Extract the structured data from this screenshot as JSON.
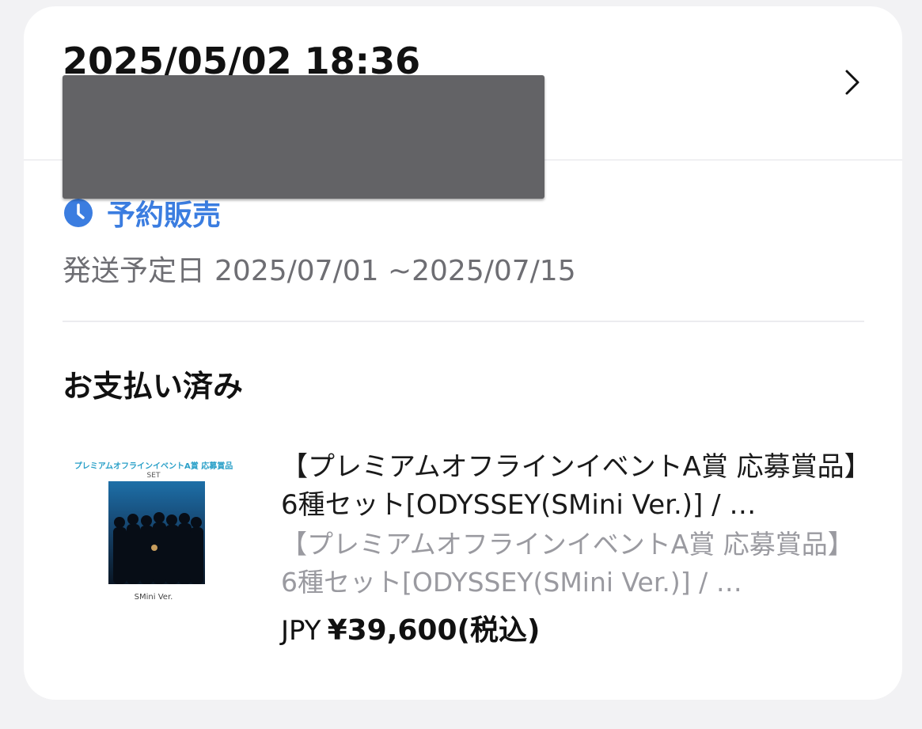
{
  "order": {
    "datetime": "2025/05/02 18:36",
    "detail_icon": "chevron-right-icon"
  },
  "status": {
    "label": "予約販売",
    "icon": "clock-icon",
    "color": "#3b7de0"
  },
  "shipping": {
    "label": "発送予定日",
    "range": "2025/07/01 ~2025/07/15"
  },
  "payment": {
    "title": "お支払い済み"
  },
  "product": {
    "thumbnail": {
      "title": "プレミアムオフラインイベントA賞 応募賞品",
      "set_label": "SET",
      "version_label": "SMini Ver."
    },
    "name": "【プレミアムオフラインイベントA賞 応募賞品】6種セット[ODYSSEY(SMini Ver.)] / …",
    "option": "【プレミアムオフラインイベントA賞 応募賞品】6種セット[ODYSSEY(SMini Ver.)] / …",
    "currency": "JPY",
    "price": "¥39,600(税込)"
  }
}
